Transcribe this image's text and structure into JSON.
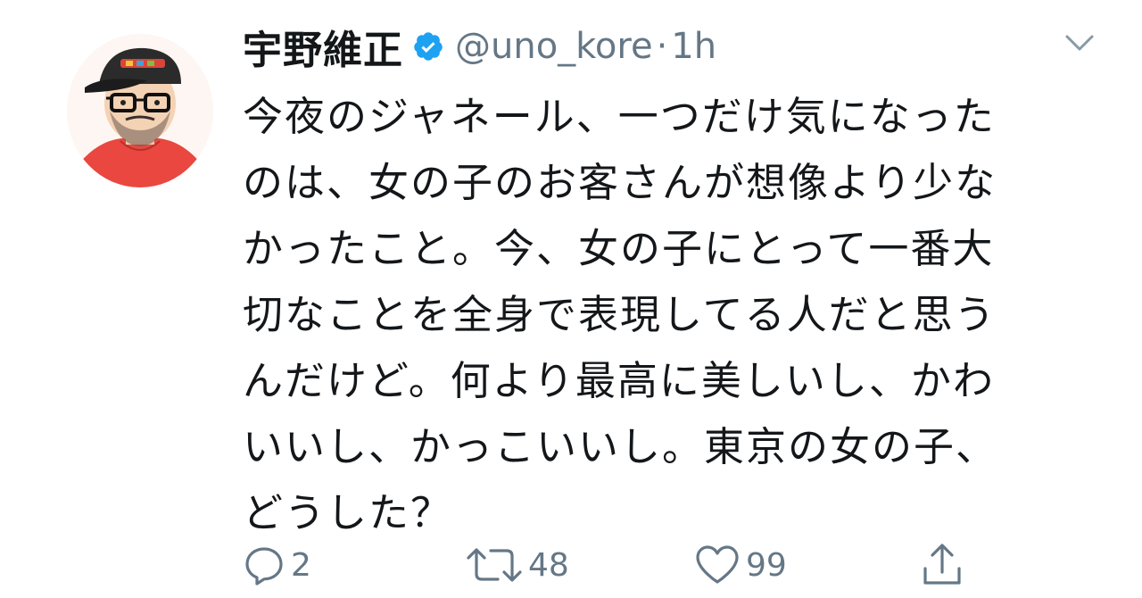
{
  "tweet": {
    "display_name": "宇野維正",
    "handle": "@uno_kore",
    "separator": "·",
    "time": "1h",
    "verified": true,
    "text_lines": [
      "今夜のジャネール、一つだけ気になった",
      "のは、女の子のお客さんが想像より少な",
      "かったこと。今、女の子にとって一番大",
      "切なことを全身で表現してる人だと思う",
      "んだけど。何より最高に美しいし、かわ",
      "いいし、かっこいいし。東京の女の子、",
      "どうした？"
    ],
    "actions": {
      "reply_count": "2",
      "retweet_count": "48",
      "like_count": "99"
    },
    "icons": {
      "verified": "verified-badge-icon",
      "caret": "chevron-down-icon",
      "reply": "reply-icon",
      "retweet": "retweet-icon",
      "like": "heart-icon",
      "share": "share-icon"
    },
    "colors": {
      "verified_blue": "#1da1f2",
      "secondary_text": "#657786",
      "primary_text": "#14171a"
    }
  }
}
